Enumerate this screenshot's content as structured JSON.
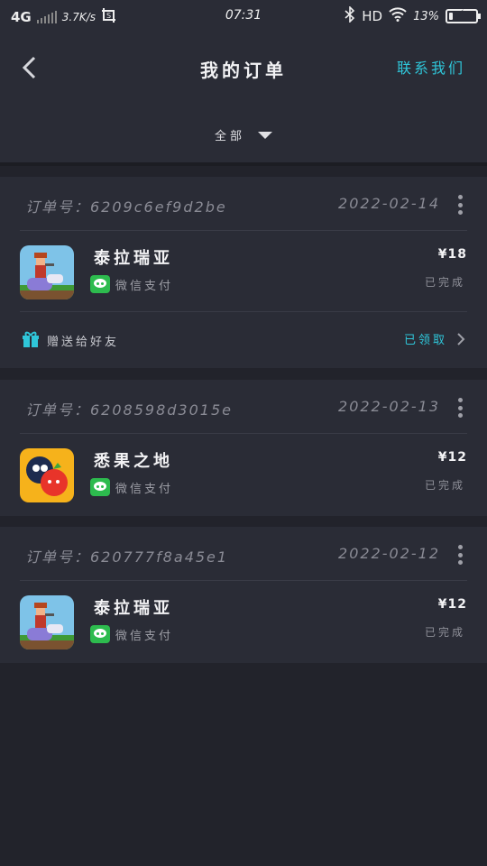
{
  "status_bar": {
    "network": "4G",
    "speed": "3.7K/s",
    "time": "07:31",
    "hd": "HD",
    "battery_percent": "13%",
    "battery_level": 0.13
  },
  "header": {
    "title": "我的订单",
    "contact": "联系我们",
    "filter_label": "全部"
  },
  "colors": {
    "accent": "#2fc6d9",
    "background": "#22232b",
    "card": "#2a2c36",
    "wechat_green": "#2dbb4e"
  },
  "orders": [
    {
      "order_id": "订单号：6209c6ef9d2be",
      "date": "2022-02-14",
      "product_name": "泰拉瑞亚",
      "payment": "微信支付",
      "price": "¥18",
      "status": "已完成",
      "icon": "terraria-game-icon",
      "gift": {
        "label": "赠送给好友",
        "action": "已领取"
      }
    },
    {
      "order_id": "订单号：6208598d3015e",
      "date": "2022-02-13",
      "product_name": "悉果之地",
      "payment": "微信支付",
      "price": "¥12",
      "status": "已完成",
      "icon": "fruit-game-icon"
    },
    {
      "order_id": "订单号：620777f8a45e1",
      "date": "2022-02-12",
      "product_name": "泰拉瑞亚",
      "payment": "微信支付",
      "price": "¥12",
      "status": "已完成",
      "icon": "terraria-game-icon"
    }
  ]
}
